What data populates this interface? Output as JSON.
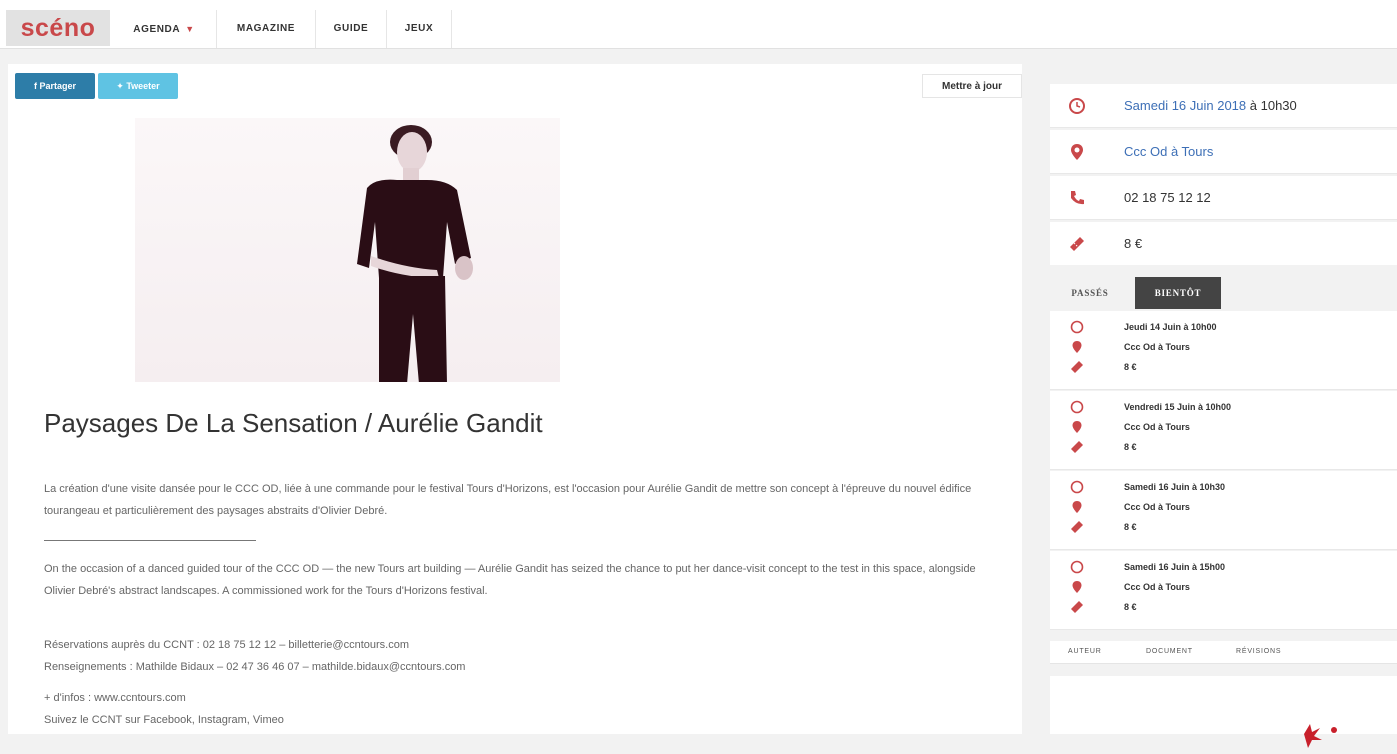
{
  "nav": {
    "logo": "scéno",
    "items": [
      {
        "label": "AGENDA",
        "has_caret": true
      },
      {
        "label": "MAGAZINE"
      },
      {
        "label": "GUIDE"
      },
      {
        "label": "JEUX"
      }
    ]
  },
  "share": {
    "facebook_label": "f Partager",
    "twitter_label": "Tweeter",
    "update_label": "Mettre à jour"
  },
  "article": {
    "title": "Paysages De La Sensation / Aurélie Gandit",
    "para_fr": "La création d'une visite dansée pour le CCC OD, liée à une commande pour le festival Tours d'Horizons, est l'occasion pour Aurélie Gandit de mettre son concept à l'épreuve du nouvel édifice tourangeau et particulièrement des paysages abstraits d'Olivier Debré.",
    "para_en": "On the occasion of a danced guided tour of the CCC OD — the new Tours art building — Aurélie Gandit has seized the chance to put her dance-visit concept to the test in this space, alongside Olivier Debré's abstract landscapes. A commissioned work for the Tours d'Horizons festival.",
    "reservations": "Réservations auprès du CCNT : 02 18 75 12 12 – billetterie@ccntours.com",
    "renseignements": "Renseignements : Mathilde Bidaux – 02 47 36 46 07 – mathilde.bidaux@ccntours.com",
    "infos": "+ d'infos : www.ccntours.com",
    "suivez": "Suivez le CCNT sur Facebook, Instagram, Vimeo"
  },
  "sidebar": {
    "date": "Samedi 16 Juin 2018",
    "time_suffix": " à 10h30",
    "location": "Ccc Od à Tours",
    "phone": "02 18 75 12 12",
    "price": "8 €",
    "tabs": {
      "passes": "PASSÉS",
      "bientot": "BIENTÔT"
    },
    "events": [
      {
        "date": "Jeudi 14 Juin à 10h00",
        "location": "Ccc Od à Tours",
        "price": "8 €"
      },
      {
        "date": "Vendredi 15 Juin à 10h00",
        "location": "Ccc Od à Tours",
        "price": "8 €"
      },
      {
        "date": "Samedi 16 Juin à 10h30",
        "location": "Ccc Od à Tours",
        "price": "8 €"
      },
      {
        "date": "Samedi 16 Juin à 15h00",
        "location": "Ccc Od à Tours",
        "price": "8 €"
      }
    ],
    "bottom_tabs": [
      "AUTEUR",
      "DOCUMENT",
      "RÉVISIONS"
    ]
  },
  "colors": {
    "accent_red": "#c9484a",
    "link_blue": "#3d6fb6",
    "facebook": "#2d7da8",
    "twitter": "#5fc3e3"
  }
}
